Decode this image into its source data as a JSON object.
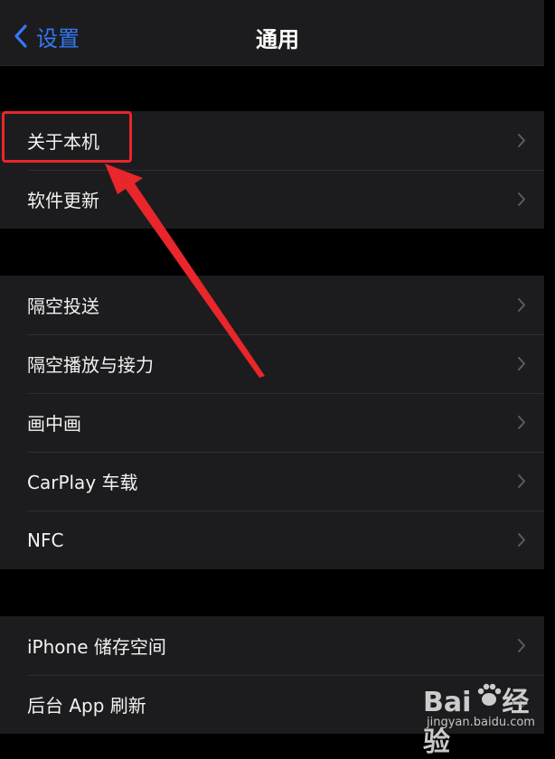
{
  "nav": {
    "back_label": "设置",
    "title": "通用"
  },
  "groups": [
    {
      "items": [
        {
          "label": "关于本机"
        },
        {
          "label": "软件更新"
        }
      ]
    },
    {
      "items": [
        {
          "label": "隔空投送"
        },
        {
          "label": "隔空播放与接力"
        },
        {
          "label": "画中画"
        },
        {
          "label": "CarPlay 车载"
        },
        {
          "label": "NFC"
        }
      ]
    },
    {
      "items": [
        {
          "label": "iPhone 储存空间"
        },
        {
          "label": "后台 App 刷新"
        }
      ]
    }
  ],
  "annotation": {
    "highlight_color": "#e8262b",
    "target": "关于本机"
  },
  "watermark": {
    "brand_left": "Bai",
    "brand_right": "经验",
    "url": "jingyan.baidu.com"
  },
  "colors": {
    "accent": "#3478f6",
    "cell_bg": "#1c1c1e",
    "page_bg": "#000000"
  }
}
